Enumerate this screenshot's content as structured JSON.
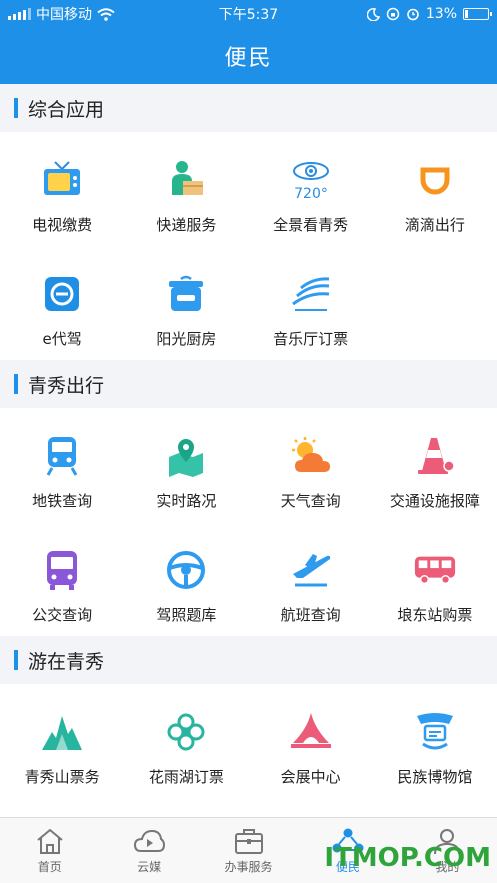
{
  "status": {
    "carrier": "中国移动",
    "time": "下午5:37",
    "battery": "13%",
    "battery_level": 0.13
  },
  "header": {
    "title": "便民"
  },
  "sections": [
    {
      "title": "综合应用",
      "items": [
        {
          "label": "电视缴费",
          "icon": "tv-icon"
        },
        {
          "label": "快递服务",
          "icon": "courier-icon"
        },
        {
          "label": "全景看青秀",
          "icon": "panorama-720-icon"
        },
        {
          "label": "滴滴出行",
          "icon": "didi-icon"
        },
        {
          "label": "e代驾",
          "icon": "edaijia-icon"
        },
        {
          "label": "阳光厨房",
          "icon": "cooker-icon"
        },
        {
          "label": "音乐厅订票",
          "icon": "concert-hall-icon"
        }
      ]
    },
    {
      "title": "青秀出行",
      "items": [
        {
          "label": "地铁查询",
          "icon": "metro-icon"
        },
        {
          "label": "实时路况",
          "icon": "map-pin-icon"
        },
        {
          "label": "天气查询",
          "icon": "weather-icon"
        },
        {
          "label": "交通设施报障",
          "icon": "traffic-cone-icon"
        },
        {
          "label": "公交查询",
          "icon": "bus-icon"
        },
        {
          "label": "驾照题库",
          "icon": "steering-wheel-icon"
        },
        {
          "label": "航班查询",
          "icon": "airplane-icon"
        },
        {
          "label": "埌东站购票",
          "icon": "coach-icon"
        }
      ]
    },
    {
      "title": "游在青秀",
      "items": [
        {
          "label": "青秀山票务",
          "icon": "mountain-icon"
        },
        {
          "label": "花雨湖订票",
          "icon": "flower-icon"
        },
        {
          "label": "会展中心",
          "icon": "convention-center-icon"
        },
        {
          "label": "民族博物馆",
          "icon": "museum-icon"
        }
      ]
    }
  ],
  "tabs": [
    {
      "label": "首页",
      "icon": "home-icon"
    },
    {
      "label": "云媒",
      "icon": "cloud-play-icon"
    },
    {
      "label": "办事服务",
      "icon": "briefcase-icon"
    },
    {
      "label": "便民",
      "icon": "share-people-icon",
      "active": true
    },
    {
      "label": "我的",
      "icon": "user-icon"
    }
  ],
  "watermark": "ITMOP.COM",
  "colors": {
    "primary": "#1e90e8",
    "watermark": "#2ea43a"
  }
}
